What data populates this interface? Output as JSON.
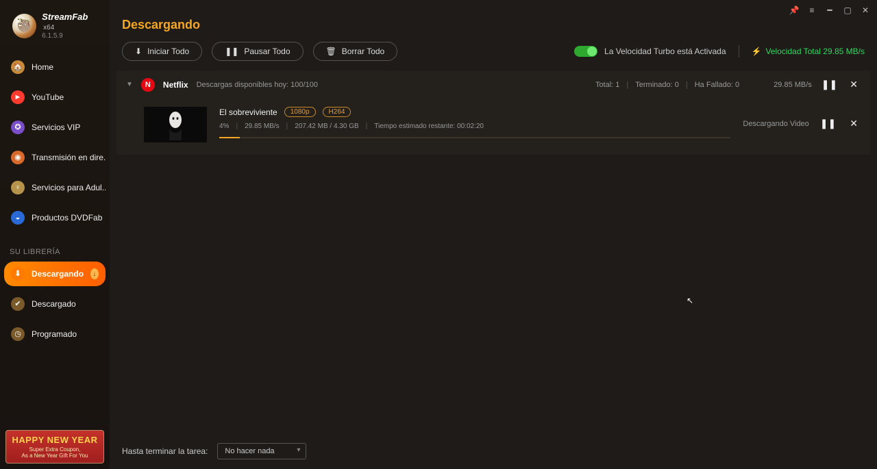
{
  "app": {
    "name": "StreamFab",
    "arch": "x64",
    "version": "6.1.5.9"
  },
  "sidebar": {
    "items": [
      {
        "label": "Home",
        "icon": "🏠",
        "bg": "#c78a3a"
      },
      {
        "label": "YouTube",
        "icon": "►",
        "bg": "#ff3b30"
      },
      {
        "label": "Servicios VIP",
        "icon": "✪",
        "bg": "#7a4ec7"
      },
      {
        "label": "Transmisión en dire...",
        "icon": "◉",
        "bg": "#d76a2a"
      },
      {
        "label": "Servicios para Adul...",
        "icon": "♀",
        "bg": "#b5934a"
      },
      {
        "label": "Productos DVDFab",
        "icon": "◒",
        "bg": "#2a6ad7"
      }
    ],
    "section_label": "SU LIBRERÍA",
    "library": [
      {
        "label": "Descargando",
        "icon": "⬇",
        "bg": "#ff7a00",
        "active": true
      },
      {
        "label": "Descargado",
        "icon": "✔",
        "bg": "#7a5a2a"
      },
      {
        "label": "Programado",
        "icon": "◷",
        "bg": "#7a5a2a"
      }
    ]
  },
  "promo": {
    "title": "HAPPY NEW YEAR",
    "line1": "Super Extra Coupon,",
    "line2": "As a New Year Gift For You"
  },
  "page": {
    "title": "Descargando"
  },
  "toolbar": {
    "start_all": "Iniciar Todo",
    "pause_all": "Pausar Todo",
    "clear_all": "Borrar Todo",
    "turbo_label": "La Velocidad Turbo está Activada",
    "total_speed_label": "Velocidad Total 29.85 MB/s"
  },
  "group": {
    "service": "Netflix",
    "subtitle": "Descargas disponibles hoy: 100/100",
    "total_label": "Total: 1",
    "done_label": "Terminado: 0",
    "failed_label": "Ha Fallado: 0",
    "speed": "29.85 MB/s"
  },
  "item": {
    "title": "El sobreviviente",
    "tag_res": "1080p",
    "tag_codec": "H264",
    "percent": "4%",
    "speed": "29.85 MB/s",
    "size": "207.42 MB / 4.30 GB",
    "eta": "Tiempo estimado restante: 00:02:20",
    "status": "Descargando Video",
    "progress_percent": 4
  },
  "footer": {
    "label": "Hasta terminar la tarea:",
    "select_value": "No hacer nada"
  }
}
